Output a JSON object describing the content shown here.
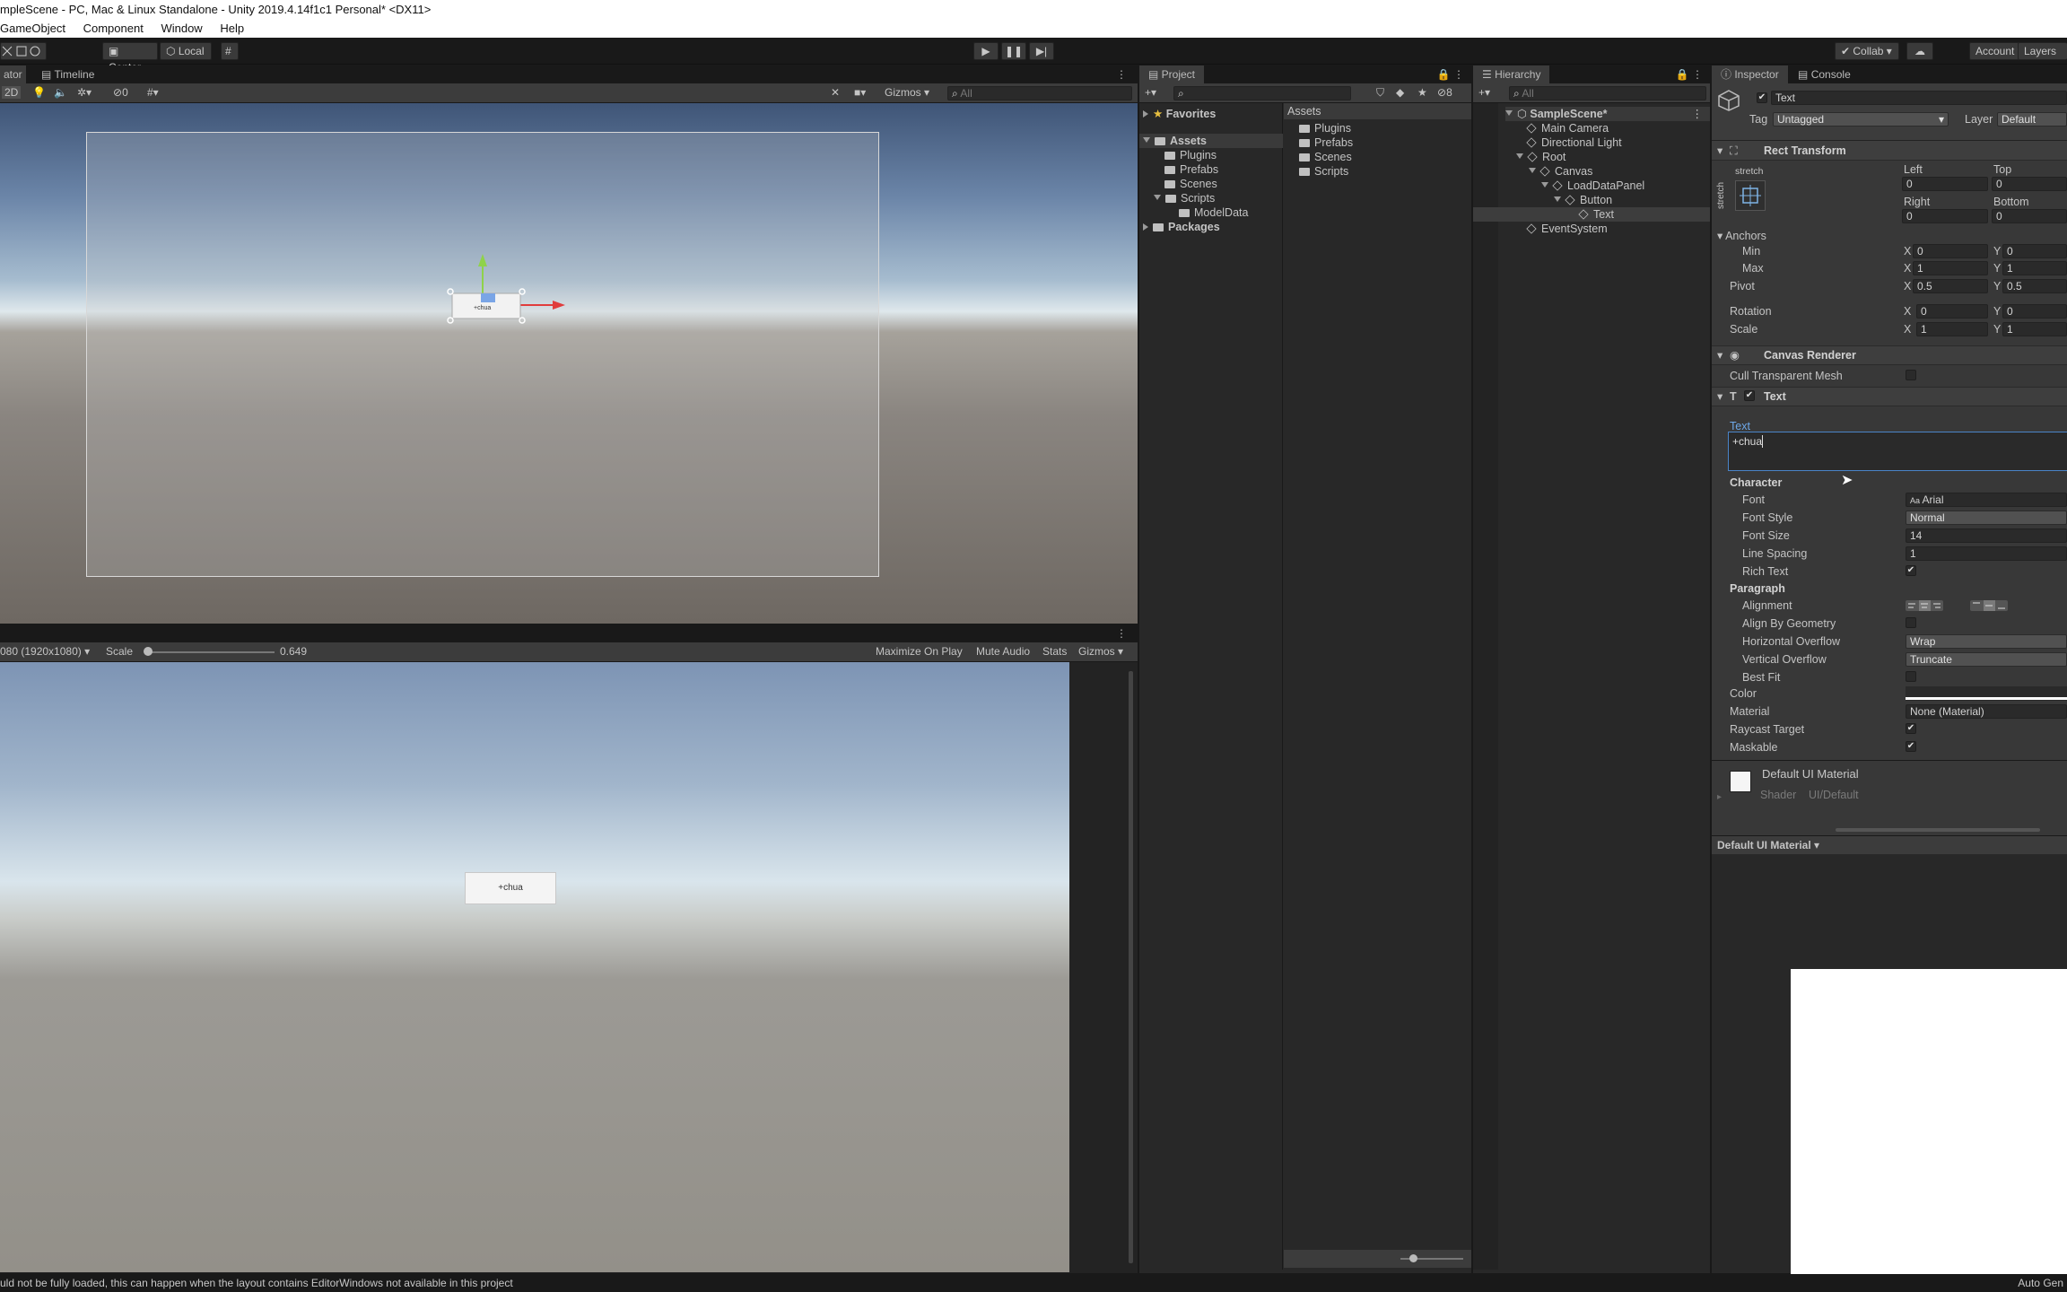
{
  "window": {
    "title": "mpleScene - PC, Mac & Linux Standalone - Unity 2019.4.14f1c1 Personal* <DX11>"
  },
  "menu": [
    "GameObject",
    "Component",
    "Window",
    "Help"
  ],
  "toolbar": {
    "center": "Center",
    "local": "Local",
    "collab": "Collab",
    "account": "Account",
    "layers": "Layers"
  },
  "scene": {
    "tab_left": "ator",
    "tab_timeline": "Timeline",
    "mode_2d": "2D",
    "hidden_count": "0",
    "gizmos": "Gizmos",
    "search_placeholder": "All",
    "button_text": "+chua"
  },
  "game": {
    "resolution": "080 (1920x1080)",
    "scale_label": "Scale",
    "scale_value": "0.649",
    "maximize": "Maximize On Play",
    "mute": "Mute Audio",
    "stats": "Stats",
    "gizmos": "Gizmos",
    "button_text": "+chua"
  },
  "project": {
    "tab": "Project",
    "hidden_count": "8",
    "tree": {
      "favorites": "Favorites",
      "assets": "Assets",
      "plugins": "Plugins",
      "prefabs": "Prefabs",
      "scenes": "Scenes",
      "scripts": "Scripts",
      "modeldata": "ModelData",
      "packages": "Packages"
    },
    "breadcrumb": "Assets",
    "items": [
      "Plugins",
      "Prefabs",
      "Scenes",
      "Scripts"
    ]
  },
  "hierarchy": {
    "tab": "Hierarchy",
    "search_placeholder": "All",
    "scene": "SampleScene*",
    "items": {
      "camera": "Main Camera",
      "light": "Directional Light",
      "root": "Root",
      "canvas": "Canvas",
      "panel": "LoadDataPanel",
      "button": "Button",
      "text": "Text",
      "eventsystem": "EventSystem"
    }
  },
  "inspector": {
    "tab": "Inspector",
    "tab_console": "Console",
    "object_name": "Text",
    "tag_label": "Tag",
    "tag_value": "Untagged",
    "layer_label": "Layer",
    "layer_value": "Default",
    "rect": {
      "title": "Rect Transform",
      "stretch": "stretch",
      "stretch_side": "stretch",
      "left_label": "Left",
      "left": "0",
      "top_label": "Top",
      "top": "0",
      "right_label": "Right",
      "right": "0",
      "bottom_label": "Bottom",
      "bottom": "0",
      "anchors": "Anchors",
      "min": "Min",
      "min_x": "0",
      "min_y": "0",
      "max": "Max",
      "max_x": "1",
      "max_y": "1",
      "pivot": "Pivot",
      "pivot_x": "0.5",
      "pivot_y": "0.5",
      "rotation": "Rotation",
      "rot_x": "0",
      "rot_y": "0",
      "scale": "Scale",
      "scale_x": "1",
      "scale_y": "1",
      "x": "X",
      "y": "Y"
    },
    "canvas_renderer": {
      "title": "Canvas Renderer",
      "cull": "Cull Transparent Mesh"
    },
    "text": {
      "title": "Text",
      "text_label": "Text",
      "text_value": "+chua",
      "character": "Character",
      "font": "Font",
      "font_value": "Arial",
      "font_style": "Font Style",
      "font_style_value": "Normal",
      "font_size": "Font Size",
      "font_size_value": "14",
      "line_spacing": "Line Spacing",
      "line_spacing_value": "1",
      "rich_text": "Rich Text",
      "paragraph": "Paragraph",
      "alignment": "Alignment",
      "align_geo": "Align By Geometry",
      "h_overflow": "Horizontal Overflow",
      "h_overflow_value": "Wrap",
      "v_overflow": "Vertical Overflow",
      "v_overflow_value": "Truncate",
      "best_fit": "Best Fit",
      "color": "Color",
      "material": "Material",
      "material_value": "None (Material)",
      "raycast": "Raycast Target",
      "maskable": "Maskable"
    },
    "material": {
      "name": "Default UI Material",
      "shader_label": "Shader",
      "shader_value": "UI/Default"
    },
    "preview": {
      "title": "Default UI Material"
    }
  },
  "status": {
    "message": "uld not be fully loaded, this can happen when the layout contains EditorWindows not available in this project",
    "right": "Auto Gen"
  }
}
